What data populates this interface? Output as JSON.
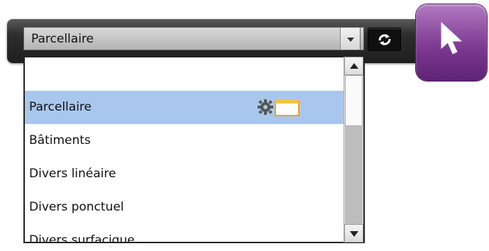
{
  "combo": {
    "selected_value": "Parcellaire"
  },
  "dropdown": {
    "items": [
      {
        "label": "Parcellaire",
        "selected": true,
        "icons": [
          "gear-icon",
          "folder-icon"
        ]
      },
      {
        "label": "Bâtiments"
      },
      {
        "label": "Divers linéaire"
      },
      {
        "label": "Divers ponctuel"
      },
      {
        "label": "Divers surfacique"
      }
    ]
  },
  "colors": {
    "selected_row": "#a9c7ec",
    "pointer_tool": "#7d3a92",
    "toolbar": "#1e1e1e"
  },
  "icons": {
    "action_button": "refresh-layer-icon",
    "pointer_tool": "cursor-arrow-icon"
  }
}
